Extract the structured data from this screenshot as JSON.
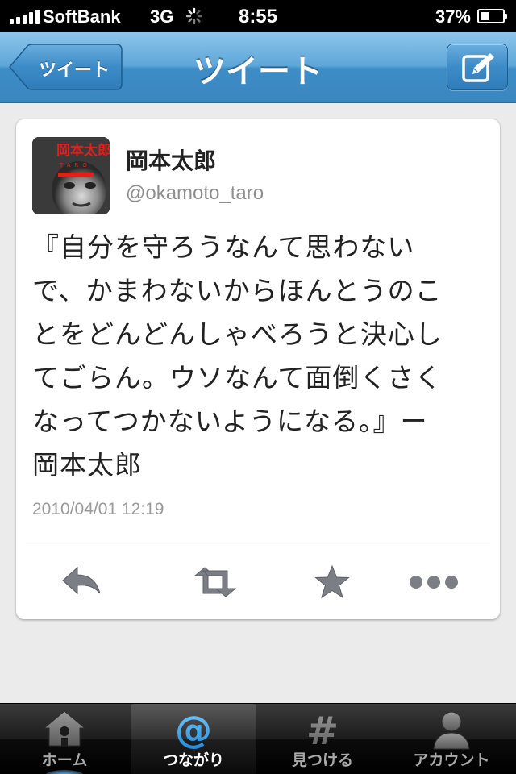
{
  "status_bar": {
    "carrier": "SoftBank",
    "network": "3G",
    "time": "8:55",
    "battery_percent": "37%",
    "battery_level": 0.37
  },
  "nav": {
    "back_label": "ツイート",
    "title": "ツイート",
    "compose_icon": "compose-icon"
  },
  "tweet": {
    "display_name": "岡本太郎",
    "handle": "@okamoto_taro",
    "lines": [
      "『自分を守ろうなんて思わない",
      "で、かまわないからほんとうのこ",
      "とをどんどんしゃべろうと決心し",
      "てごらん。ウソなんて面倒くさく",
      "なってつかないようになる。』ー",
      "岡本太郎"
    ],
    "timestamp": "2010/04/01 12:19",
    "avatar_text": "岡本太郎"
  },
  "actions": [
    {
      "icon": "reply-icon"
    },
    {
      "icon": "retweet-icon"
    },
    {
      "icon": "star-icon"
    },
    {
      "icon": "more-icon"
    }
  ],
  "tabs": [
    {
      "label": "ホーム",
      "icon": "home-icon",
      "active": false
    },
    {
      "label": "つながり",
      "icon": "at-icon",
      "active": true
    },
    {
      "label": "見つける",
      "icon": "hash-icon",
      "active": false
    },
    {
      "label": "アカウント",
      "icon": "account-icon",
      "active": false
    }
  ],
  "colors": {
    "nav_blue": "#3e8cc6",
    "tab_active_blue": "#1d95e8",
    "background": "#ebebeb"
  }
}
